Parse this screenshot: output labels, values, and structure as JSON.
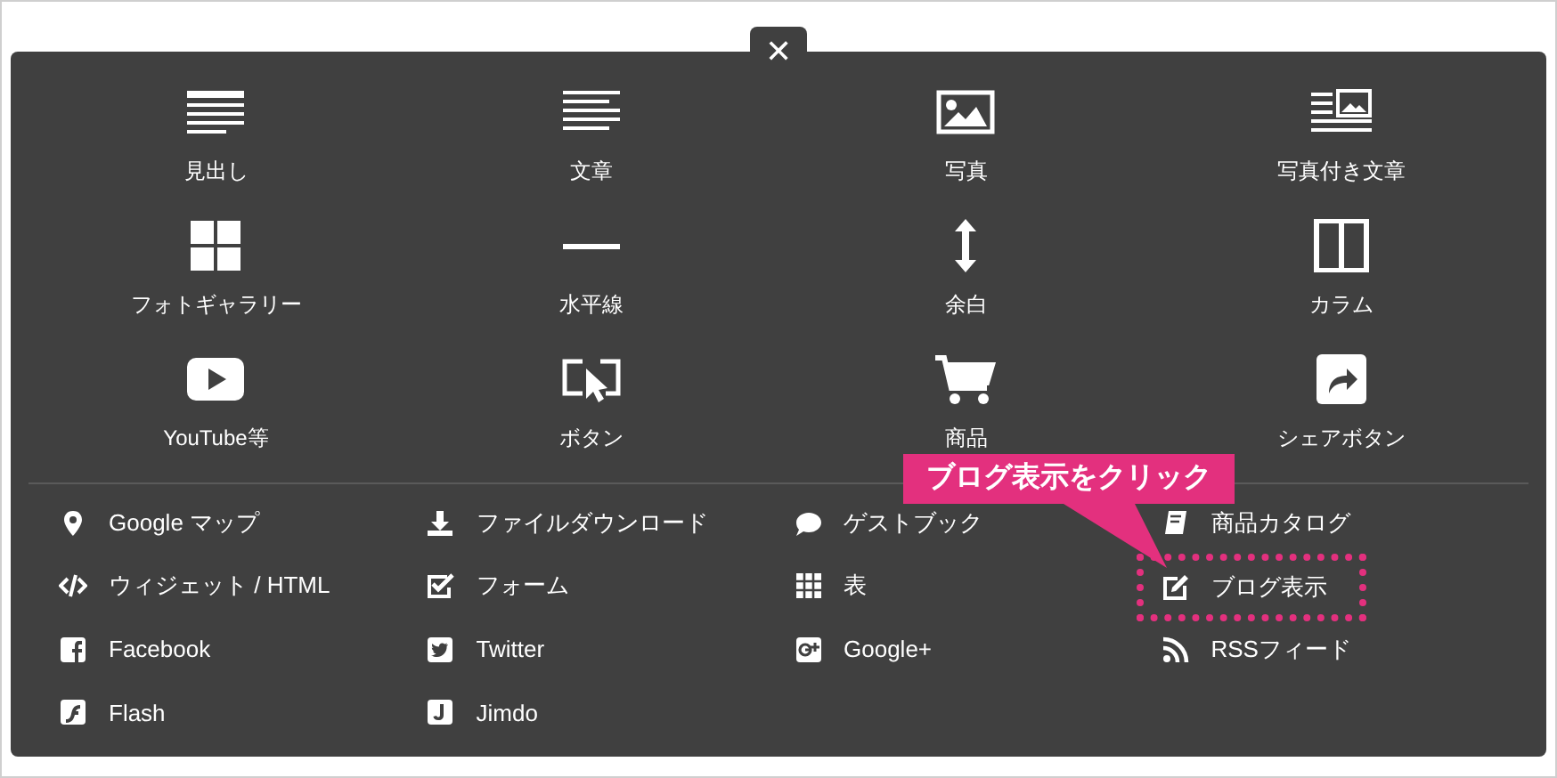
{
  "close_button": {
    "label": "✕"
  },
  "blocks": [
    {
      "label": "見出し"
    },
    {
      "label": "文章"
    },
    {
      "label": "写真"
    },
    {
      "label": "写真付き文章"
    },
    {
      "label": "フォトギャラリー"
    },
    {
      "label": "水平線"
    },
    {
      "label": "余白"
    },
    {
      "label": "カラム"
    },
    {
      "label": "YouTube等"
    },
    {
      "label": "ボタン"
    },
    {
      "label": "商品"
    },
    {
      "label": "シェアボタン"
    }
  ],
  "links": [
    {
      "label": "Google マップ",
      "highlighted": false
    },
    {
      "label": "ファイルダウンロード",
      "highlighted": false
    },
    {
      "label": "ゲストブック",
      "highlighted": false
    },
    {
      "label": "商品カタログ",
      "highlighted": false
    },
    {
      "label": "ウィジェット / HTML",
      "highlighted": false
    },
    {
      "label": "フォーム",
      "highlighted": false
    },
    {
      "label": "表",
      "highlighted": false
    },
    {
      "label": "ブログ表示",
      "highlighted": true
    },
    {
      "label": "Facebook",
      "highlighted": false
    },
    {
      "label": "Twitter",
      "highlighted": false
    },
    {
      "label": "Google+",
      "highlighted": false
    },
    {
      "label": "RSSフィード",
      "highlighted": false
    },
    {
      "label": "Flash",
      "highlighted": false
    },
    {
      "label": "Jimdo",
      "highlighted": false
    }
  ],
  "callout": {
    "text": "ブログ表示をクリック"
  }
}
